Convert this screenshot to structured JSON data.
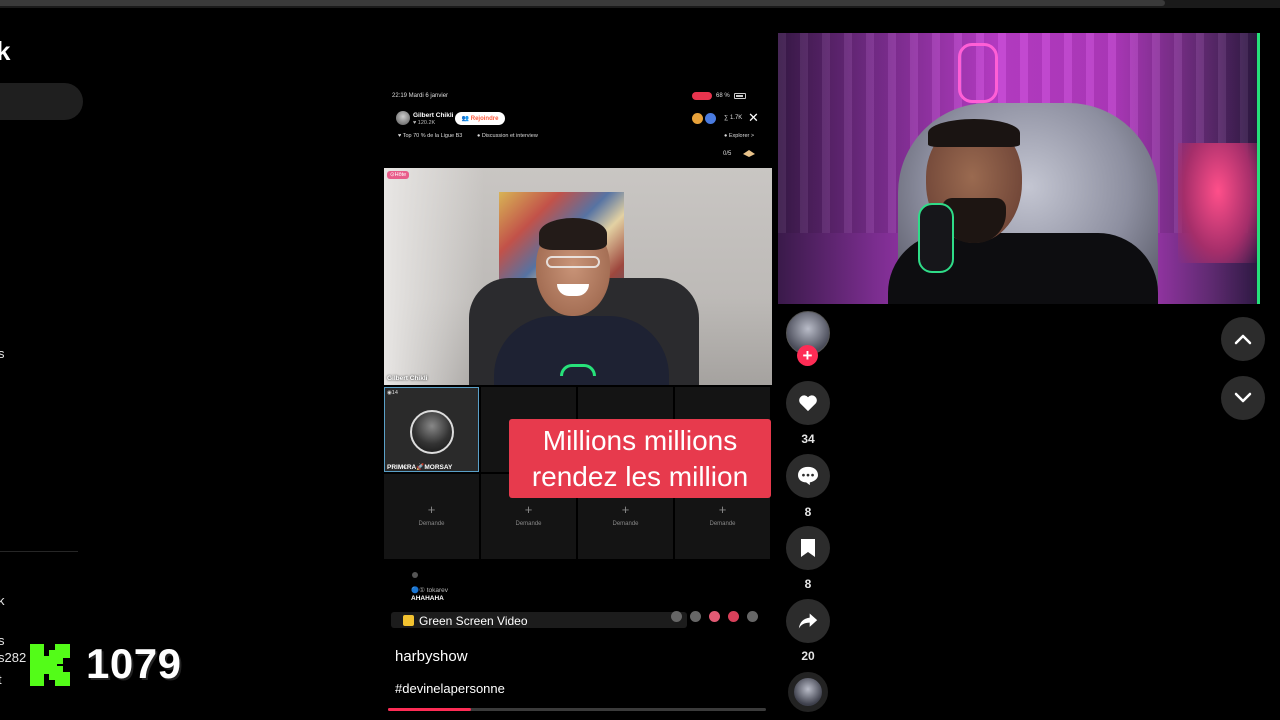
{
  "sidebar": {
    "logo_fragment": "k",
    "fragments": [
      {
        "text": "s"
      },
      {
        "text": "k"
      },
      {
        "text": "s"
      },
      {
        "text": "s282"
      },
      {
        "text": "t"
      }
    ]
  },
  "stream_counter": {
    "logo_letter": "K",
    "count": "1079",
    "brand_color": "#53fc18"
  },
  "phone": {
    "status_time": "22:19  Mardi 6 janvier",
    "battery": "68 %",
    "host": {
      "name": "Gilbert Chikli",
      "likes": "♥ 120.2K",
      "join_label": "👥 Rejoindre"
    },
    "viewers": "∑ 1.7K",
    "close_label": "✕",
    "tags": {
      "ranking": "♥ Top 70 % de la Ligue B3",
      "topic": "● Discussion et interview",
      "explore": "● Explorer >"
    },
    "seat_count": "0/5",
    "main_video": {
      "badge": "⊙Hôte",
      "name": "Gilbert Chikli"
    },
    "guest": {
      "number": "◉14",
      "name": "PRIM€RA🚀MORSAY"
    },
    "empty_seats": [
      {
        "plus": "+",
        "label": "Demande"
      },
      {
        "plus": "+",
        "label": "Demande"
      },
      {
        "plus": "+",
        "label": "Demande"
      },
      {
        "plus": "+",
        "label": "Demande"
      }
    ],
    "caption": {
      "line1": "Millions millions",
      "line2": "rendez les million",
      "color": "#e73a4d"
    },
    "chat": {
      "user": "🔵① tokarev",
      "message": "AHAHAHA"
    },
    "effect_label": "Green Screen Video"
  },
  "video": {
    "author": "harbyshow",
    "hashtag": "#devinelapersonne",
    "progress": 0.22
  },
  "actions": {
    "likes": "34",
    "comments": "8",
    "saves": "8",
    "shares": "20",
    "follow_label": "+"
  },
  "icons": [
    "heart-icon",
    "comment-icon",
    "bookmark-icon",
    "share-icon",
    "chevron-up-icon",
    "chevron-down-icon"
  ],
  "colors": {
    "accent": "#fe2c55",
    "background": "#000000",
    "button_bg": "#2c2c2c"
  }
}
